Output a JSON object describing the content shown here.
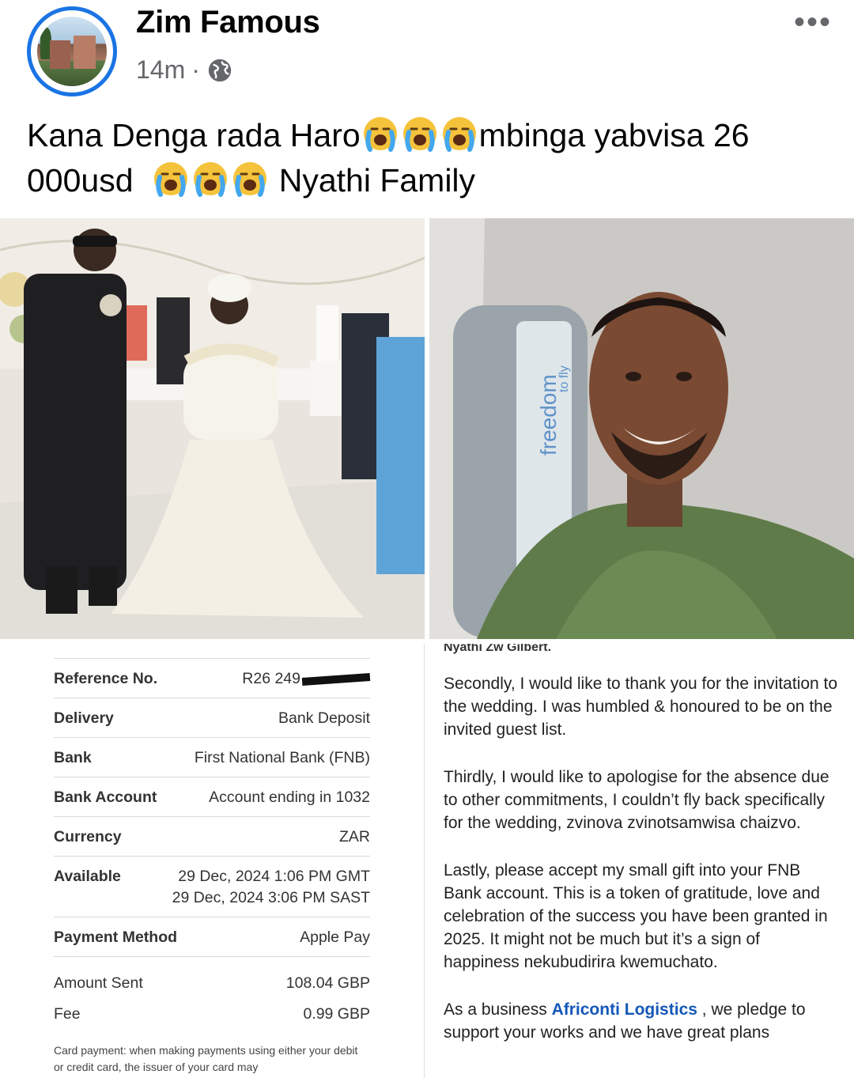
{
  "post": {
    "author": "Zim Famous",
    "time": "14m",
    "separator": "·",
    "more": "•••",
    "caption_part1": "Kana Denga rada Haro",
    "caption_part2": "mbinga yabvisa 26 000usd",
    "caption_part3": "Nyathi Family"
  },
  "photos": {
    "headrest_text": "freedom",
    "headrest_sub": "to fly"
  },
  "receipt": {
    "rows": [
      {
        "label": "Reference No.",
        "value": "R26 249"
      },
      {
        "label": "Delivery",
        "value": "Bank Deposit"
      },
      {
        "label": "Bank",
        "value": "First National Bank (FNB)"
      },
      {
        "label": "Bank Account",
        "value": "Account ending in 1032"
      },
      {
        "label": "Currency",
        "value": "ZAR"
      },
      {
        "label": "Available",
        "value": "29 Dec, 2024 1:06 PM GMT",
        "value2": "29 Dec, 2024 3:06 PM SAST"
      },
      {
        "label": "Payment Method",
        "value": "Apple Pay"
      },
      {
        "label": "Amount Sent",
        "value": "108.04 GBP"
      },
      {
        "label": "Fee",
        "value": "0.99 GBP"
      }
    ],
    "fine_print": "Card payment: when making payments using either your debit or credit card, the issuer of your card may"
  },
  "letter": {
    "cut_top": "Nyathi Zw Gilbert.",
    "para1": "Secondly, I would like to thank you for the invitation to the wedding. I was humbled & honoured to be on the invited guest list.",
    "para2": "Thirdly, I would like to apologise for the absence due to other commitments, I couldn’t fly back specifically for the wedding, zvinova zvinotsamwisa chaizvo.",
    "para3": "Lastly, please accept my small gift into your FNB Bank account. This is a token of gratitude, love and celebration of the success you have been granted in 2025. It might not be much but it’s a sign of happiness nekubudirira kwemuchato.",
    "para4_a": "As a business ",
    "para4_link": "Africonti Logistics",
    "para4_b": " , we pledge to support your works and we have great plans"
  }
}
